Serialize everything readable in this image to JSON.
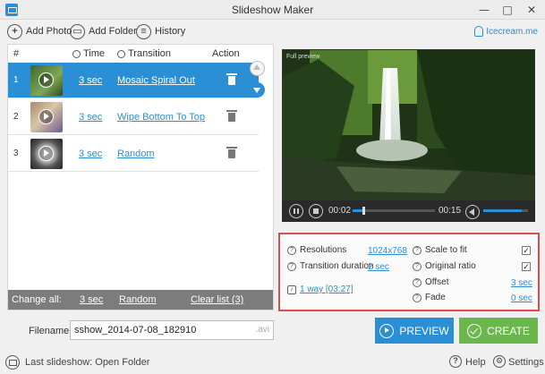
{
  "window": {
    "title": "Slideshow Maker",
    "minimize": "—",
    "maximize": "□",
    "close": "✕"
  },
  "toolbar": {
    "add_photo": "Add Photo",
    "add_folder": "Add Folder",
    "history": "History",
    "brand": "Icecream.me"
  },
  "table": {
    "headers": {
      "num": "#",
      "time": "Time",
      "transition": "Transition",
      "action": "Action"
    },
    "rows": [
      {
        "num": "1",
        "time": "3 sec",
        "transition": "Mosaic Spiral Out",
        "selected": true
      },
      {
        "num": "2",
        "time": "3 sec",
        "transition": "Wipe Bottom To Top",
        "selected": false
      },
      {
        "num": "3",
        "time": "3 sec",
        "transition": "Random",
        "selected": false
      }
    ]
  },
  "change_all": {
    "label": "Change all:",
    "time": "3 sec",
    "transition": "Random",
    "clear": "Clear list (3)"
  },
  "player": {
    "label": "Full preview",
    "elapsed": "00:02",
    "total": "00:15",
    "progress": 0.13,
    "volume": 0.85
  },
  "settings": {
    "resolutions_label": "Resolutions",
    "resolutions_value": "1024x768",
    "transition_duration_label": "Transition duration",
    "transition_duration_value": "2 sec",
    "audio_value": "1 way [03:27]",
    "scale_label": "Scale to fit",
    "scale_checked": true,
    "original_label": "Original ratio",
    "original_checked": true,
    "offset_label": "Offset",
    "offset_value": "3 sec",
    "fade_label": "Fade",
    "fade_value": "0 sec"
  },
  "filename": {
    "label": "Filename:",
    "value": "sshow_2014-07-08_182910",
    "ext": ".avi"
  },
  "buttons": {
    "preview": "PREVIEW",
    "create": "CREATE"
  },
  "statusbar": {
    "last": "Last slideshow: Open Folder",
    "help": "Help",
    "settings": "Settings"
  },
  "colors": {
    "accent": "#2b8fd6",
    "create": "#6ab84b",
    "highlight_border": "#d94f4f"
  }
}
